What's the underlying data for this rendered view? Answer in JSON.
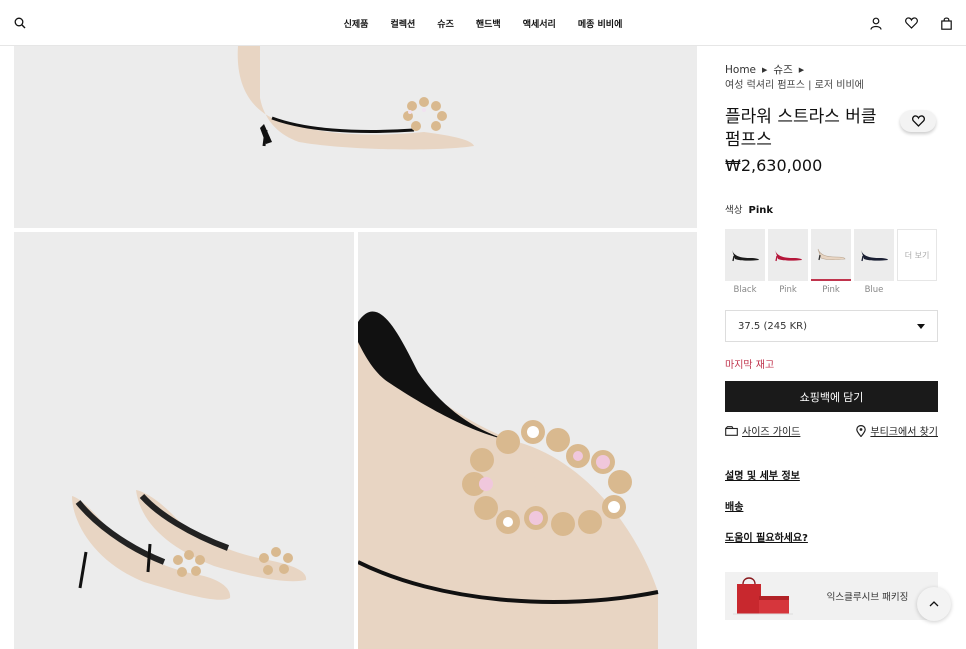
{
  "nav": {
    "items": [
      {
        "label": "신제품"
      },
      {
        "label": "컬렉션"
      },
      {
        "label": "슈즈"
      },
      {
        "label": "핸드백"
      },
      {
        "label": "액세서리"
      },
      {
        "label": "메종 비비에"
      }
    ]
  },
  "header_icons": [
    "search-icon",
    "user-icon",
    "heart-icon",
    "bag-icon"
  ],
  "breadcrumb": {
    "items": [
      "Home",
      "슈즈"
    ],
    "subtitle": "여성 럭셔리 펌프스 | 로저 비비에"
  },
  "product": {
    "title": "플라워 스트라스 버클 펌프스",
    "price": "₩2,630,000",
    "color_label": "색상",
    "color_value": "Pink",
    "swatches": [
      {
        "label": "Black",
        "color": "#1b1b1b",
        "selected": false
      },
      {
        "label": "Pink",
        "color": "#b5163a",
        "selected": false
      },
      {
        "label": "Pink",
        "color": "#e8d5c3",
        "selected": true
      },
      {
        "label": "Blue",
        "color": "#1a1f33",
        "selected": false
      }
    ],
    "more_label": "더 보기",
    "size_value": "37.5 (245 KR)",
    "stock_text": "마지막 재고",
    "add_to_bag": "쇼핑백에 담기",
    "size_guide": "사이즈 가이드",
    "find_boutique": "부티크에서 찾기"
  },
  "sections": [
    "설명 및 세부 정보",
    "배송",
    "도움이 필요하세요?"
  ],
  "packaging": {
    "label": "익스클루시브 패키징"
  },
  "colors": {
    "accent": "#c0344d",
    "button": "#1a1a1a",
    "image_bg": "#ececec"
  }
}
